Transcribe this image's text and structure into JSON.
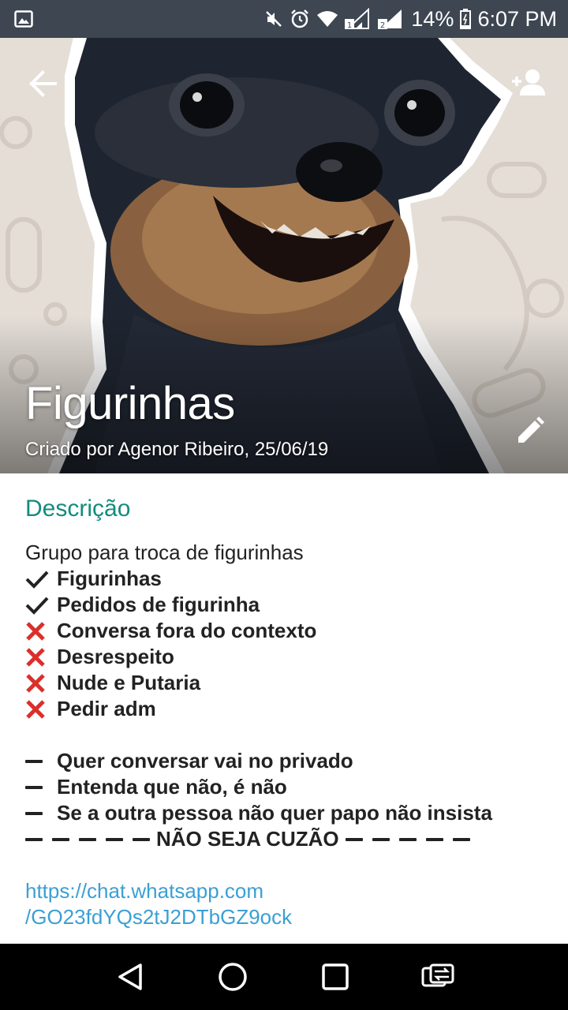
{
  "status_bar": {
    "battery_percent": "14%",
    "time": "6:07 PM",
    "sim1": "1",
    "sim2": "2",
    "icons": [
      "image-icon",
      "mute-icon",
      "alarm-icon",
      "wifi-icon",
      "signal-icon",
      "battery-icon"
    ]
  },
  "header": {
    "title": "Figurinhas",
    "subtitle": "Criado por Agenor Ribeiro, 25/06/19",
    "icons": [
      "back-arrow-icon",
      "add-participant-icon",
      "edit-pencil-icon"
    ]
  },
  "description": {
    "label": "Descrição",
    "intro": "Grupo para troca de figurinhas",
    "allowed": [
      "Figurinhas",
      "Pedidos de figurinha"
    ],
    "forbidden": [
      "Conversa fora do contexto",
      "Desrespeito",
      "Nude e Putaria",
      "Pedir adm"
    ],
    "rules": [
      "Quer conversar vai no privado",
      "Entenda que não, é não",
      "Se a outra pessoa não quer papo não insista"
    ],
    "banner": "NÃO SEJA CUZÃO",
    "link_line1": "https://chat.whatsapp.com",
    "link_line2": "/GO23fdYQs2tJ2DTbGZ9ock"
  },
  "colors": {
    "accent": "#128c7e",
    "link": "#3b9fd3",
    "forbidden": "#d9302c",
    "status_bar": "#3d4651"
  },
  "nav_bar": {
    "icons": [
      "back-triangle-icon",
      "home-circle-icon",
      "recents-square-icon",
      "switch-app-icon"
    ]
  }
}
